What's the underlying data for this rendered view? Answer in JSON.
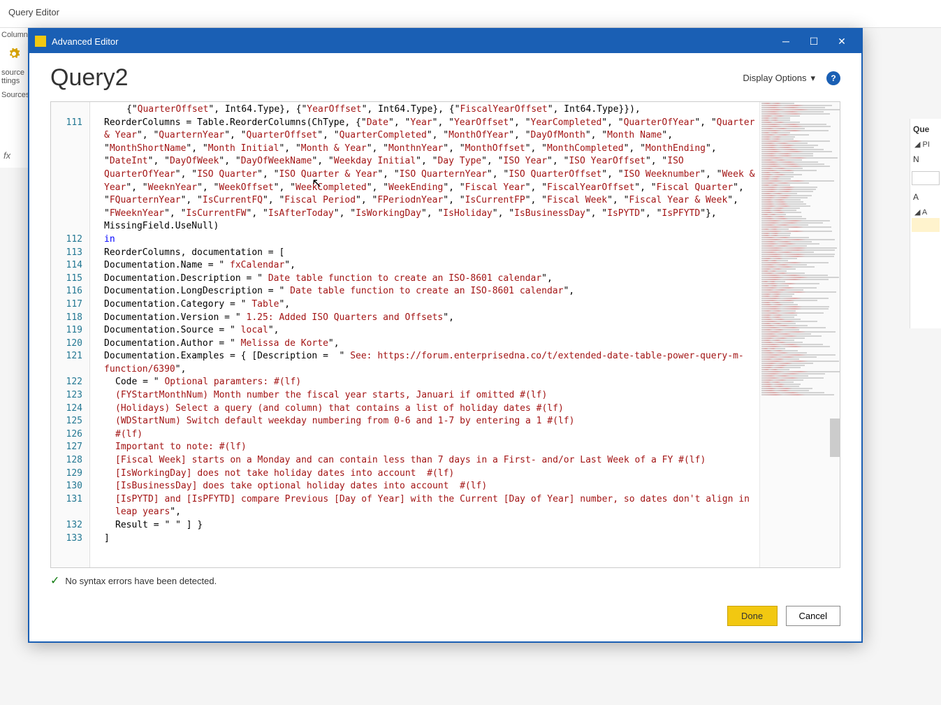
{
  "bg": {
    "window_title": "Query Editor",
    "nav_column": "Column",
    "nav_source": "source\nttings",
    "nav_sources": "Sources",
    "fx_label": "fx"
  },
  "right_panel": {
    "query_section": "Que",
    "properties_section": "PI",
    "n_label": "N",
    "field_placeholder": "",
    "all_label": "A",
    "applied_section": "A"
  },
  "modal": {
    "title": "Advanced Editor",
    "query_name": "Query2",
    "display_options_label": "Display Options",
    "syntax_status": "No syntax errors have been detected.",
    "done_label": "Done",
    "cancel_label": "Cancel"
  },
  "gutter": {
    "start_blank_count": 2,
    "numbers": [
      "111",
      "",
      "",
      "",
      "",
      "",
      "",
      "",
      "",
      "112",
      "113",
      "114",
      "115",
      "116",
      "117",
      "118",
      "119",
      "120",
      "121",
      "",
      "122",
      "123",
      "124",
      "125",
      "126",
      "127",
      "128",
      "129",
      "130",
      "131",
      "",
      "132",
      "133"
    ]
  },
  "code": {
    "l0_a": "{\"",
    "l0_b": "QuarterOffset",
    "l0_c": "\", Int64.Type}, {\"",
    "l0_d": "YearOffset",
    "l0_e": "\", Int64.Type}, {\"",
    "l0_f": "FiscalYearOffset",
    "l0_g": "\", Int64.Type}}),",
    "l1_a": "ReorderColumns = Table.ReorderColumns(ChType, {\"",
    "l1_list": [
      "Date",
      "Year",
      "YearOffset",
      "YearCompleted",
      "QuarterOfYear",
      "Quarter & Year",
      "QuarternYear",
      "QuarterOffset",
      "QuarterCompleted",
      "MonthOfYear",
      "DayOfMonth",
      "Month Name",
      "MonthShortName",
      "Month Initial",
      "Month & Year",
      "MonthnYear",
      "MonthOffset",
      "MonthCompleted",
      "MonthEnding",
      "DateInt",
      "DayOfWeek",
      "DayOfWeekName",
      "Weekday Initial",
      "Day Type",
      "ISO Year",
      "ISO YearOffset",
      "ISO QuarterOfYear",
      "ISO Quarter",
      "ISO Quarter & Year",
      "ISO QuarternYear",
      "ISO QuarterOffset",
      "ISO Weeknumber",
      "Week & Year",
      "WeeknYear",
      "WeekOffset",
      "WeekCompleted",
      "WeekEnding",
      "Fiscal Year",
      "FiscalYearOffset",
      "Fiscal Quarter",
      "FQuarternYear",
      "IsCurrentFQ",
      "Fiscal Period",
      "FPeriodnYear",
      "IsCurrentFP",
      "Fiscal Week",
      "Fiscal Year & Week",
      "FWeeknYear",
      "IsCurrentFW",
      "IsAfterToday",
      "IsWorkingDay",
      "IsHoliday",
      "IsBusinessDay",
      "IsPYTD",
      "IsPFYTD"
    ],
    "l1_tail": "}, MissingField.UseNull)",
    "l2": "in",
    "l3": "ReorderColumns, documentation = [",
    "l4_a": "Documentation.Name = \" ",
    "l4_b": "fxCalendar",
    "l4_c": "\",",
    "l5_a": "Documentation.Description = \" ",
    "l5_b": "Date table function to create an ISO-8601 calendar",
    "l5_c": "\",",
    "l6_a": "Documentation.LongDescription = \" ",
    "l6_b": "Date table function to create an ISO-8601 calendar",
    "l6_c": "\",",
    "l7_a": "Documentation.Category = \" ",
    "l7_b": "Table",
    "l7_c": "\",",
    "l8_a": "Documentation.Version = \" ",
    "l8_b": "1.25: Added ISO Quarters and Offsets",
    "l8_c": "\",",
    "l9_a": "Documentation.Source = \" ",
    "l9_b": "local",
    "l9_c": "\",",
    "l10_a": "Documentation.Author = \" ",
    "l10_b": "Melissa de Korte",
    "l10_c": "\",",
    "l11_a": "Documentation.Examples = { [Description =  \" ",
    "l11_b": "See: https://forum.enterprisedna.co/t/extended-date-table-power-query-m-function/6390",
    "l11_c": "\",",
    "l12_a": "Code = \" ",
    "l12_b": "Optional paramters: #(lf)",
    "l13": "(FYStartMonthNum) Month number the fiscal year starts, Januari if omitted #(lf)",
    "l14": "(Holidays) Select a query (and column) that contains a list of holiday dates #(lf)",
    "l15": "(WDStartNum) Switch default weekday numbering from 0-6 and 1-7 by entering a 1 #(lf)",
    "l16": "#(lf)",
    "l17": "Important to note: #(lf)",
    "l18": "[Fiscal Week] starts on a Monday and can contain less than 7 days in a First- and/or Last Week of a FY #(lf)",
    "l19": "[IsWorkingDay] does not take holiday dates into account  #(lf)",
    "l20": "[IsBusinessDay] does take optional holiday dates into account  #(lf)",
    "l21": "[IsPYTD] and [IsPFYTD] compare Previous [Day of Year] with the Current [Day of Year] number, so dates don't align in leap years",
    "l21_c": "\",",
    "l22_a": "Result = \" ",
    "l22_b": "\" ] }",
    "l23": "]"
  }
}
